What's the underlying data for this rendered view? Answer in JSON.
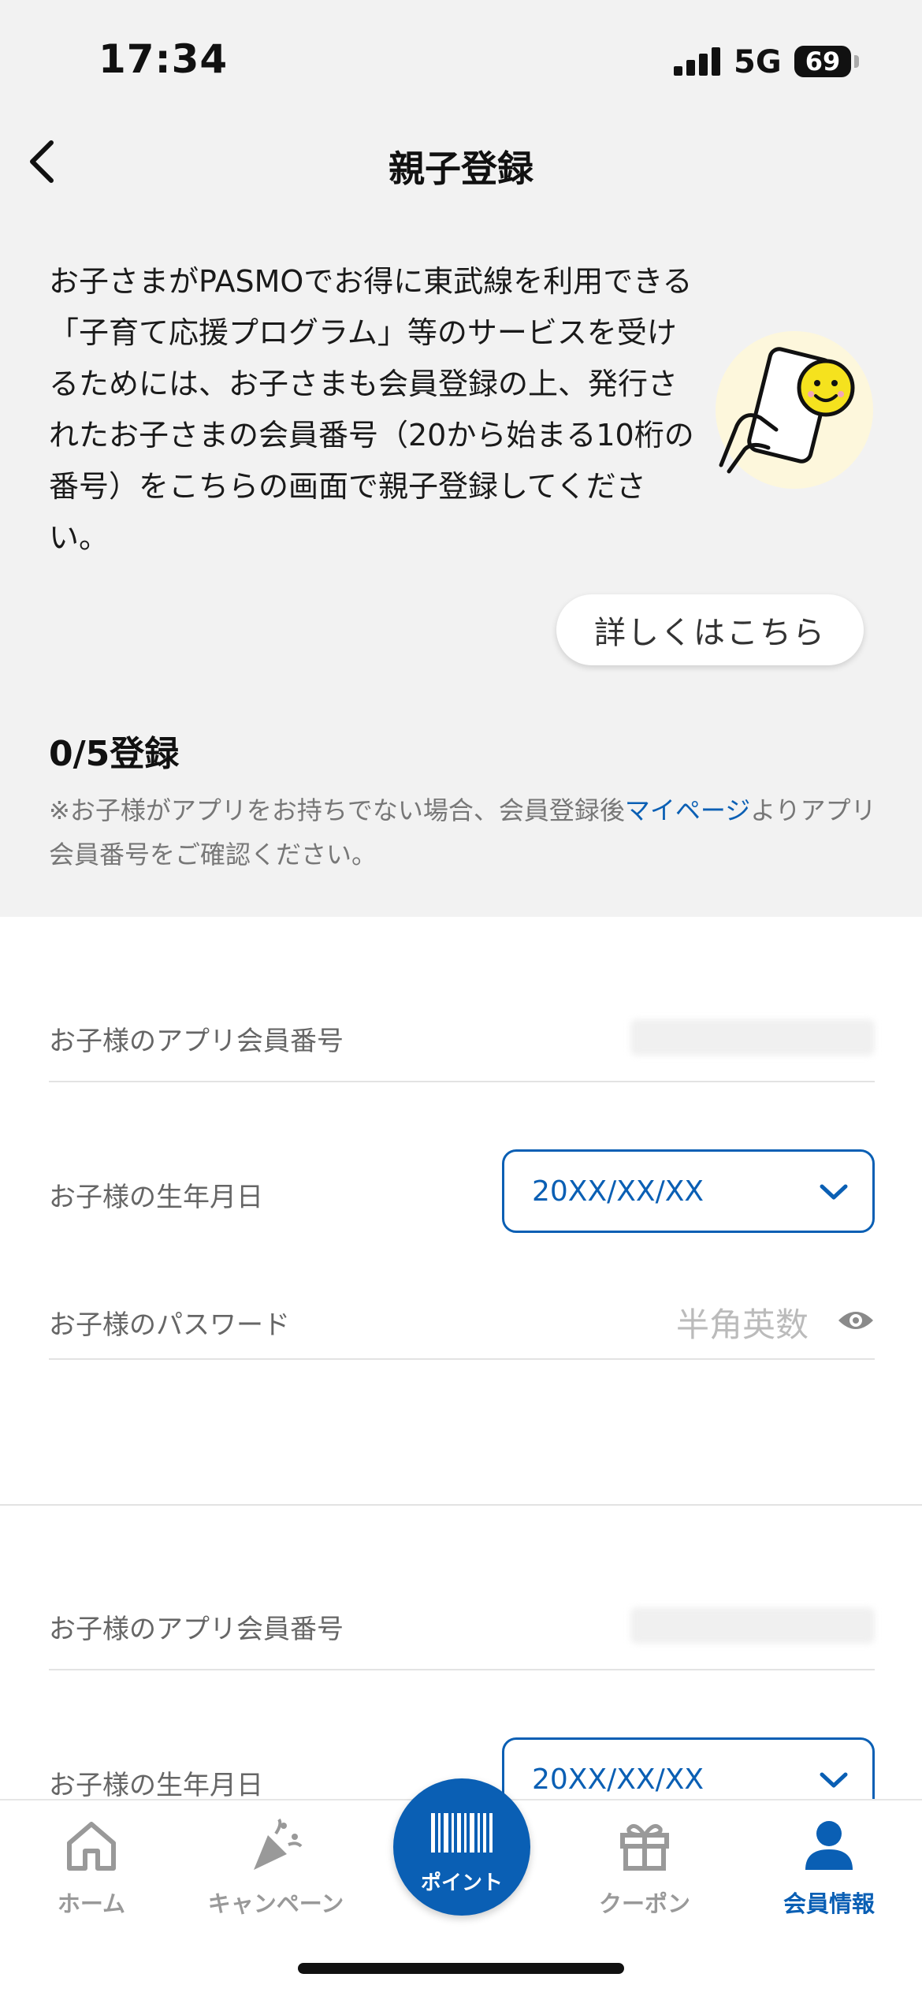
{
  "status_bar": {
    "time": "17:34",
    "network": "5G",
    "battery": "69"
  },
  "header": {
    "title": "親子登録",
    "back_icon": "chevron-left-icon"
  },
  "intro": {
    "text": "お子さまがPASMOでお得に東武線を利用できる「子育て応援プログラム」等のサービスを受けるためには、お子さまも会員登録の上、発行されたお子さまの会員番号（20から始まる10桁の番号）をこちらの画面で親子登録してください。",
    "illustration": "phone-smiley-illustration"
  },
  "detail_button": {
    "label": "詳しくはこちら"
  },
  "registration": {
    "count": "0/5登録",
    "note_prefix": "※お子様がアプリをお持ちでない場合、会員登録後",
    "note_link": "マイページ",
    "note_suffix": "よりアプリ会員番号をご確認ください。"
  },
  "forms": [
    {
      "member_number_label": "お子様のアプリ会員番号",
      "birthdate_label": "お子様の生年月日",
      "birthdate_value": "20XX/XX/XX",
      "password_label": "お子様のパスワード",
      "password_placeholder": "半角英数"
    },
    {
      "member_number_label": "お子様のアプリ会員番号",
      "birthdate_label": "お子様の生年月日",
      "birthdate_value": "20XX/XX/XX"
    }
  ],
  "tab_bar": {
    "items": [
      {
        "label": "ホーム",
        "icon": "home-icon"
      },
      {
        "label": "キャンペーン",
        "icon": "party-popper-icon"
      },
      {
        "label": "ポイント",
        "icon": "barcode-icon"
      },
      {
        "label": "クーポン",
        "icon": "gift-icon"
      },
      {
        "label": "会員情報",
        "icon": "person-icon"
      }
    ],
    "active": "会員情報"
  },
  "colors": {
    "accent": "#0a5fb4",
    "background": "#f2f2f2"
  }
}
